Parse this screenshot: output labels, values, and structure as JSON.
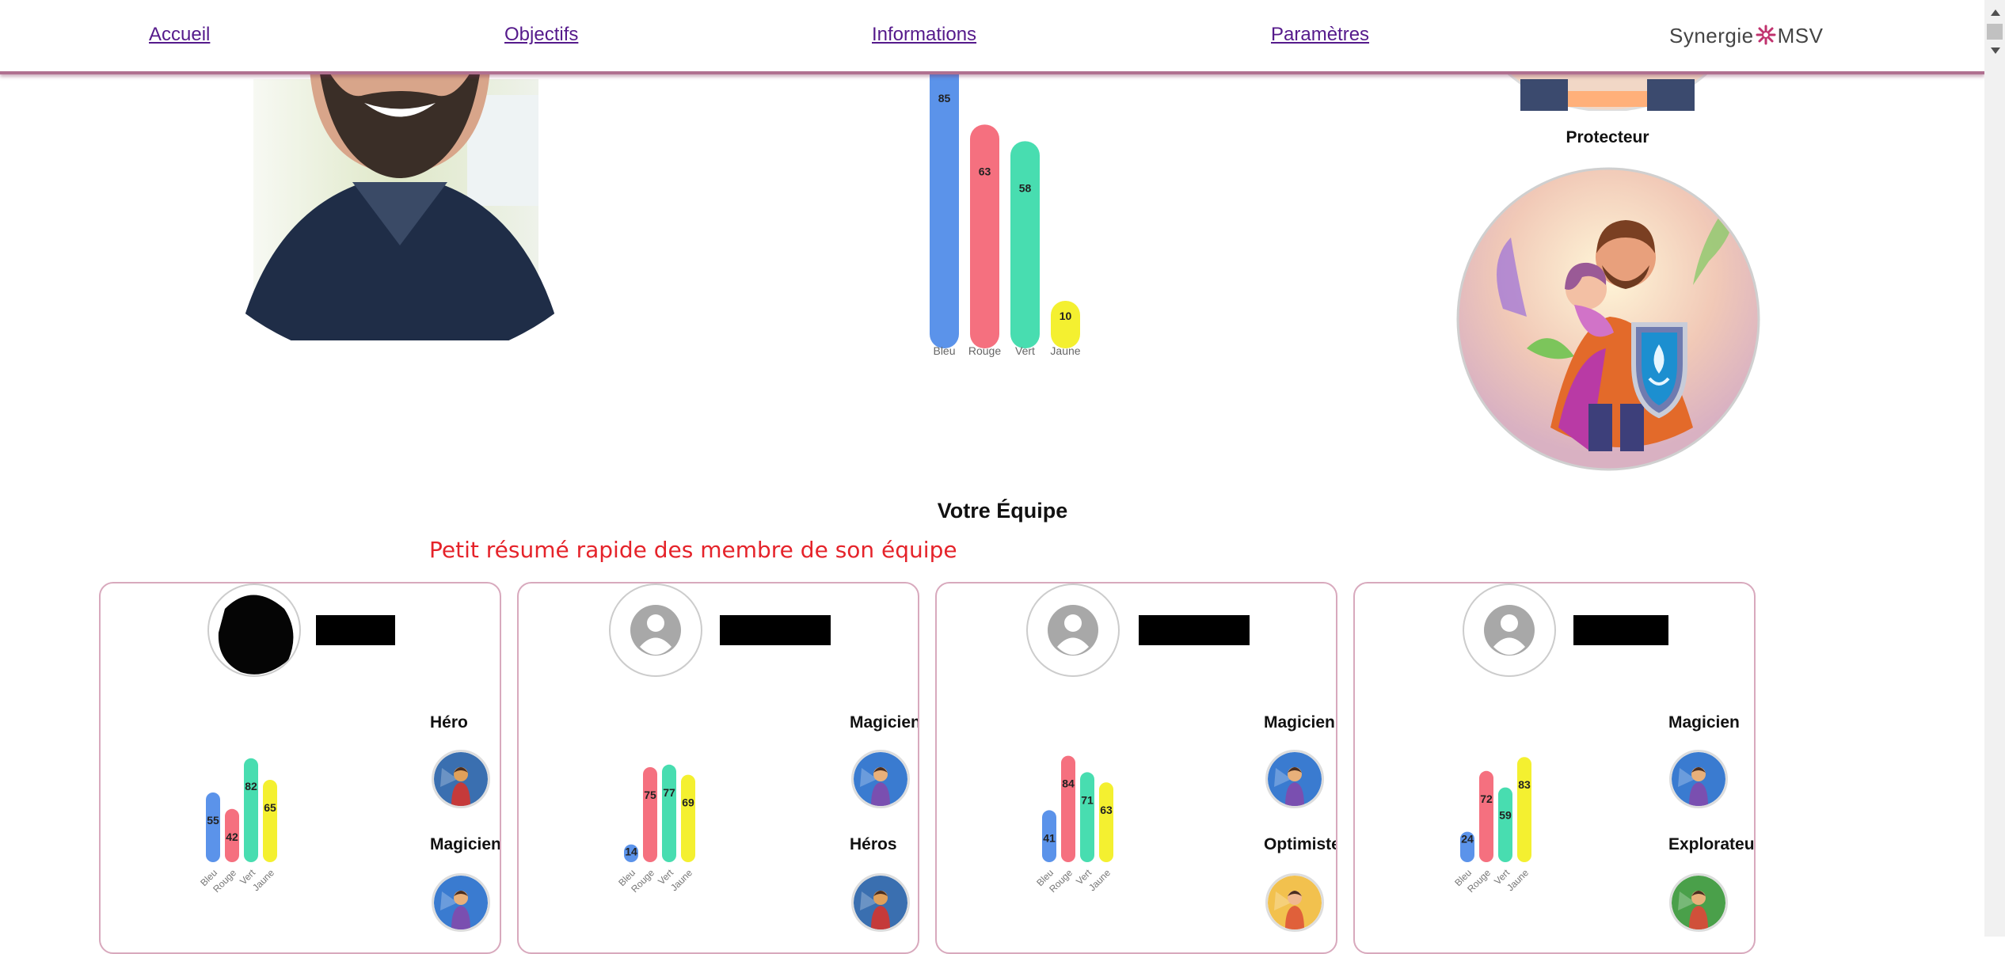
{
  "nav": {
    "links": [
      "Accueil",
      "Objectifs",
      "Informations",
      "Paramètres"
    ],
    "brand_left": "Synergie",
    "brand_right": "MSV"
  },
  "profile": {
    "archetype_label": "Protecteur"
  },
  "main_chart": {
    "type": "bar",
    "categories": [
      "Bleu",
      "Rouge",
      "Vert",
      "Jaune"
    ],
    "values": [
      85,
      63,
      58,
      10
    ],
    "colors": [
      "#5b93ea",
      "#f5707f",
      "#48ddb0",
      "#f4f030"
    ]
  },
  "team": {
    "title": "Votre Équipe",
    "summary_note": "Petit résumé rapide des membre de son équipe",
    "members": [
      {
        "roles": [
          "Héro",
          "Magicien"
        ],
        "role_icons": [
          "hero-icon",
          "magician-icon"
        ],
        "values": [
          55,
          42,
          82,
          65
        ]
      },
      {
        "roles": [
          "Magicien",
          "Héros"
        ],
        "role_icons": [
          "magician-icon",
          "hero-icon"
        ],
        "values": [
          14,
          75,
          77,
          69
        ]
      },
      {
        "roles": [
          "Magicien",
          "Optimiste"
        ],
        "role_icons": [
          "magician-icon",
          "optimist-icon"
        ],
        "values": [
          41,
          84,
          71,
          63
        ]
      },
      {
        "roles": [
          "Magicien",
          "Explorateur"
        ],
        "role_icons": [
          "magician-icon",
          "explorer-icon"
        ],
        "values": [
          24,
          72,
          59,
          83
        ]
      }
    ]
  },
  "chart_data": [
    {
      "type": "bar",
      "categories": [
        "Bleu",
        "Rouge",
        "Vert",
        "Jaune"
      ],
      "values": [
        85,
        63,
        58,
        10
      ]
    },
    {
      "type": "bar",
      "categories": [
        "Bleu",
        "Rouge",
        "Vert",
        "Jaune"
      ],
      "values": [
        55,
        42,
        82,
        65
      ]
    },
    {
      "type": "bar",
      "categories": [
        "Bleu",
        "Rouge",
        "Vert",
        "Jaune"
      ],
      "values": [
        14,
        75,
        77,
        69
      ]
    },
    {
      "type": "bar",
      "categories": [
        "Bleu",
        "Rouge",
        "Vert",
        "Jaune"
      ],
      "values": [
        41,
        84,
        71,
        63
      ]
    },
    {
      "type": "bar",
      "categories": [
        "Bleu",
        "Rouge",
        "Vert",
        "Jaune"
      ],
      "values": [
        24,
        72,
        59,
        83
      ]
    }
  ]
}
